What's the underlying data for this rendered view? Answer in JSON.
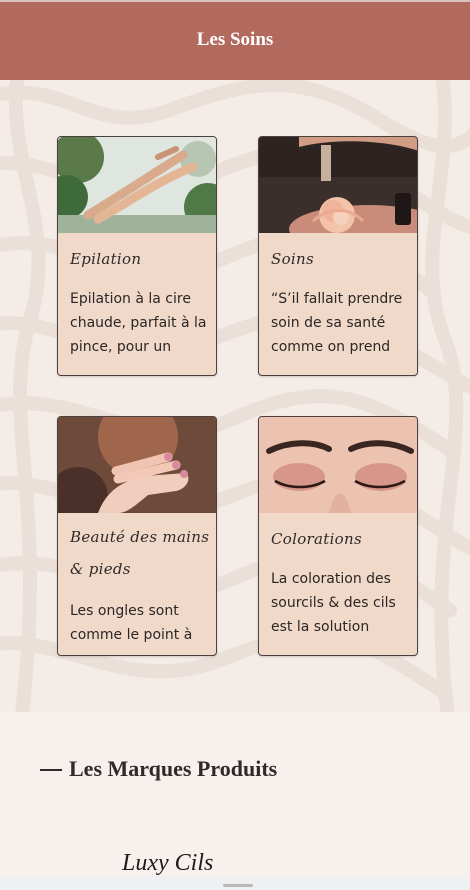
{
  "header": {
    "title": "Les Soins"
  },
  "services": [
    {
      "title": "Epilation",
      "text": "Epilation à la cire chaude, parfait à la pince, pour un",
      "image": "legs-image"
    },
    {
      "title": "Soins",
      "text": "“S’il fallait prendre soin de sa santé comme on prend",
      "image": "rose-dropper-image"
    },
    {
      "title": "Beauté des mains & pieds",
      "text": "Les ongles sont comme le point à",
      "image": "hand-nails-image"
    },
    {
      "title": "Colorations",
      "text": "La coloration des sourcils & des cils est la solution",
      "image": "eyes-makeup-image"
    }
  ],
  "brands": {
    "heading": "Les Marques Produits",
    "items": [
      "Luxy Cils"
    ]
  },
  "colors": {
    "header": "#b36a5e",
    "card": "#f1d9c9",
    "page": "#f4ece6"
  }
}
